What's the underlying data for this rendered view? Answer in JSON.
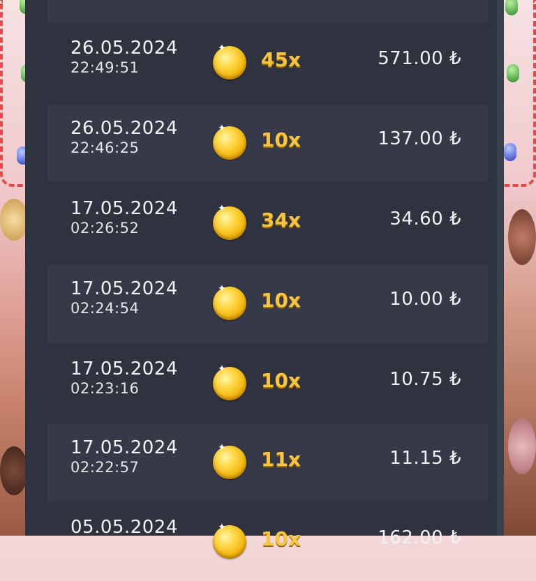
{
  "currency_symbol": "₺",
  "rows": [
    {
      "date": "",
      "time": "",
      "multiplier": "",
      "amount": ""
    },
    {
      "date": "26.05.2024",
      "time": "22:49:51",
      "multiplier": "45x",
      "amount": "571.00 ₺"
    },
    {
      "date": "26.05.2024",
      "time": "22:46:25",
      "multiplier": "10x",
      "amount": "137.00 ₺"
    },
    {
      "date": "17.05.2024",
      "time": "02:26:52",
      "multiplier": "34x",
      "amount": "34.60 ₺"
    },
    {
      "date": "17.05.2024",
      "time": "02:24:54",
      "multiplier": "10x",
      "amount": "10.00 ₺"
    },
    {
      "date": "17.05.2024",
      "time": "02:23:16",
      "multiplier": "10x",
      "amount": "10.75 ₺"
    },
    {
      "date": "17.05.2024",
      "time": "02:22:57",
      "multiplier": "11x",
      "amount": "11.15 ₺"
    },
    {
      "date": "05.05.2024",
      "time": "",
      "multiplier": "10x",
      "amount": "162.00 ₺"
    }
  ],
  "icons": {
    "coin": "gold-coin-icon",
    "sparkle": "sparkle-icon"
  },
  "colors": {
    "panel": "#2f333f",
    "row_alt": "#363a48",
    "multiplier": "#f7c443",
    "border_dash": "#e14b4b"
  }
}
